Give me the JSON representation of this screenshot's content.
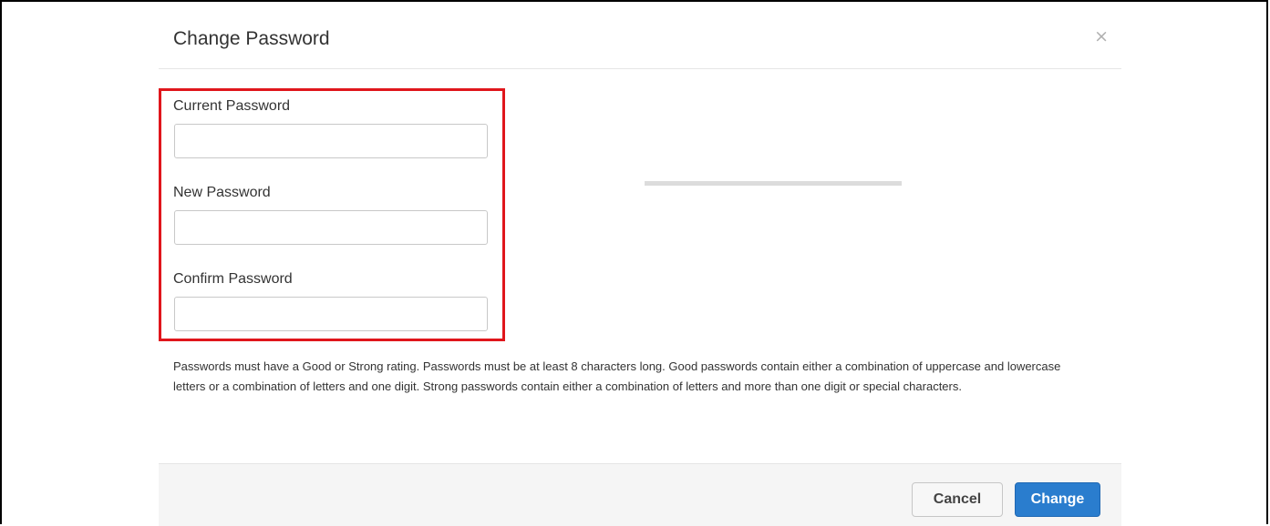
{
  "dialog": {
    "title": "Change Password",
    "close_symbol": "×"
  },
  "fields": {
    "current": {
      "label": "Current Password",
      "value": "",
      "placeholder": ""
    },
    "new": {
      "label": "New Password",
      "value": "",
      "placeholder": ""
    },
    "confirm": {
      "label": "Confirm Password",
      "value": "",
      "placeholder": ""
    }
  },
  "strength_meter": {
    "level": 0
  },
  "help_text": "Passwords must have a Good or Strong rating. Passwords must be at least 8 characters long. Good passwords contain either a combination of uppercase and lowercase letters or a combination of letters and one digit. Strong passwords contain either a combination of letters and more than one digit or special characters.",
  "footer": {
    "cancel_label": "Cancel",
    "change_label": "Change"
  },
  "colors": {
    "highlight": "#e0161c",
    "primary": "#2a7dce"
  }
}
